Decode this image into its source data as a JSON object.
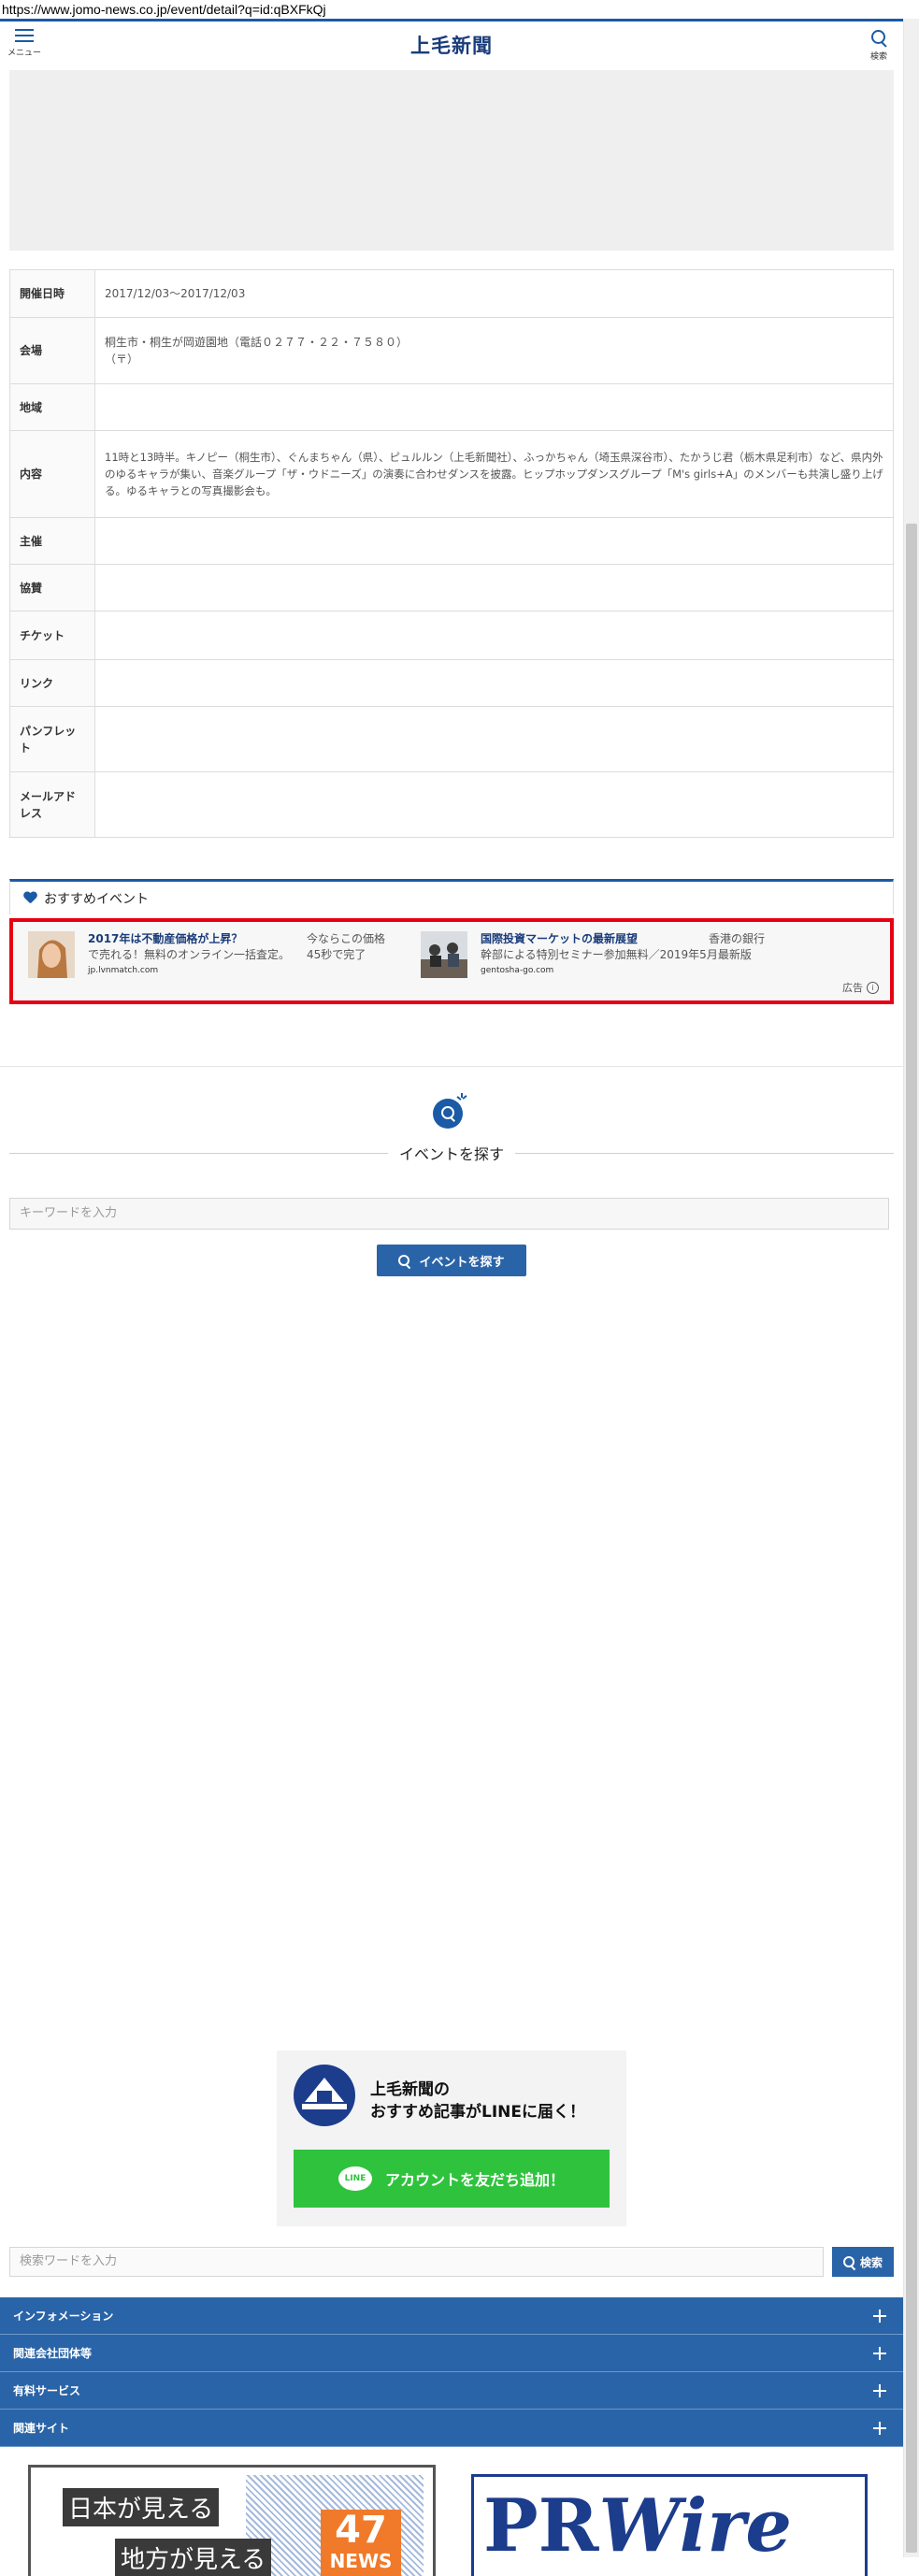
{
  "url": "https://www.jomo-news.co.jp/event/detail?q=id:qBXFkQj",
  "header": {
    "menu_label": "メニュー",
    "logo": "上毛新聞",
    "search_label": "検索"
  },
  "event_table": {
    "rows": [
      {
        "label": "開催日時",
        "value": "2017/12/03〜2017/12/03"
      },
      {
        "label": "会場",
        "value": "桐生市・桐生が岡遊園地（電話０２７７・２２・７５８０）",
        "value2": "（〒）"
      },
      {
        "label": "地域",
        "value": ""
      },
      {
        "label": "内容",
        "value": "11時と13時半。キノピー（桐生市）、ぐんまちゃん（県）、ピュルルン（上毛新聞社）、ふっかちゃん（埼玉県深谷市）、たかうじ君（栃木県足利市）など、県内外のゆるキャラが集い、音楽グループ「ザ・ウドニーズ」の演奏に合わせダンスを披露。ヒップホップダンスグループ「M's girls+A」のメンバーも共演し盛り上げる。ゆるキャラとの写真撮影会も。"
      },
      {
        "label": "主催",
        "value": ""
      },
      {
        "label": "協賛",
        "value": ""
      },
      {
        "label": "チケット",
        "value": ""
      },
      {
        "label": "リンク",
        "value": ""
      },
      {
        "label": "パンフレット",
        "value": ""
      },
      {
        "label": "メールアドレス",
        "value": ""
      }
    ]
  },
  "recommended": {
    "heading": "おすすめイベント",
    "ads": [
      {
        "title": "2017年は不動産価格が上昇？",
        "desc": "で売れる！無料のオンライン一括査定。",
        "side1": "今ならこの価格",
        "side2": "45秒で完了",
        "domain": "jp.lvnmatch.com"
      },
      {
        "title": "国際投資マーケットの最新展望",
        "desc": "幹部による特別セミナー参加無料／2019年5月最新版",
        "side1": "香港の銀行",
        "side2": "",
        "domain": "gentosha-go.com"
      }
    ],
    "ad_mark": "広告"
  },
  "find_event": {
    "title": "イベントを探す",
    "keyword_placeholder": "キーワードを入力",
    "button_label": "イベントを探す"
  },
  "line_promo": {
    "line1": "上毛新聞の",
    "line2": "おすすめ記事がLINEに届く！",
    "bubble": "LINE",
    "add_button": "アカウントを友だち追加！"
  },
  "bottom_search": {
    "placeholder": "検索ワードを入力",
    "button_label": "検索"
  },
  "accordions": [
    "インフォメーション",
    "関連会社団体等",
    "有料サービス",
    "関連サイト"
  ],
  "banners": {
    "b47_line1": "日本が見える",
    "b47_line2": "地方が見える",
    "b47_num": "47",
    "b47_news": "NEWS",
    "pr_text_a": "PR",
    "pr_text_b": "Wire"
  },
  "colors": {
    "accent": "#1a5aa6",
    "accordion": "#2a64a8",
    "highlight_border": "#e60012",
    "line_green": "#2fc33d"
  }
}
